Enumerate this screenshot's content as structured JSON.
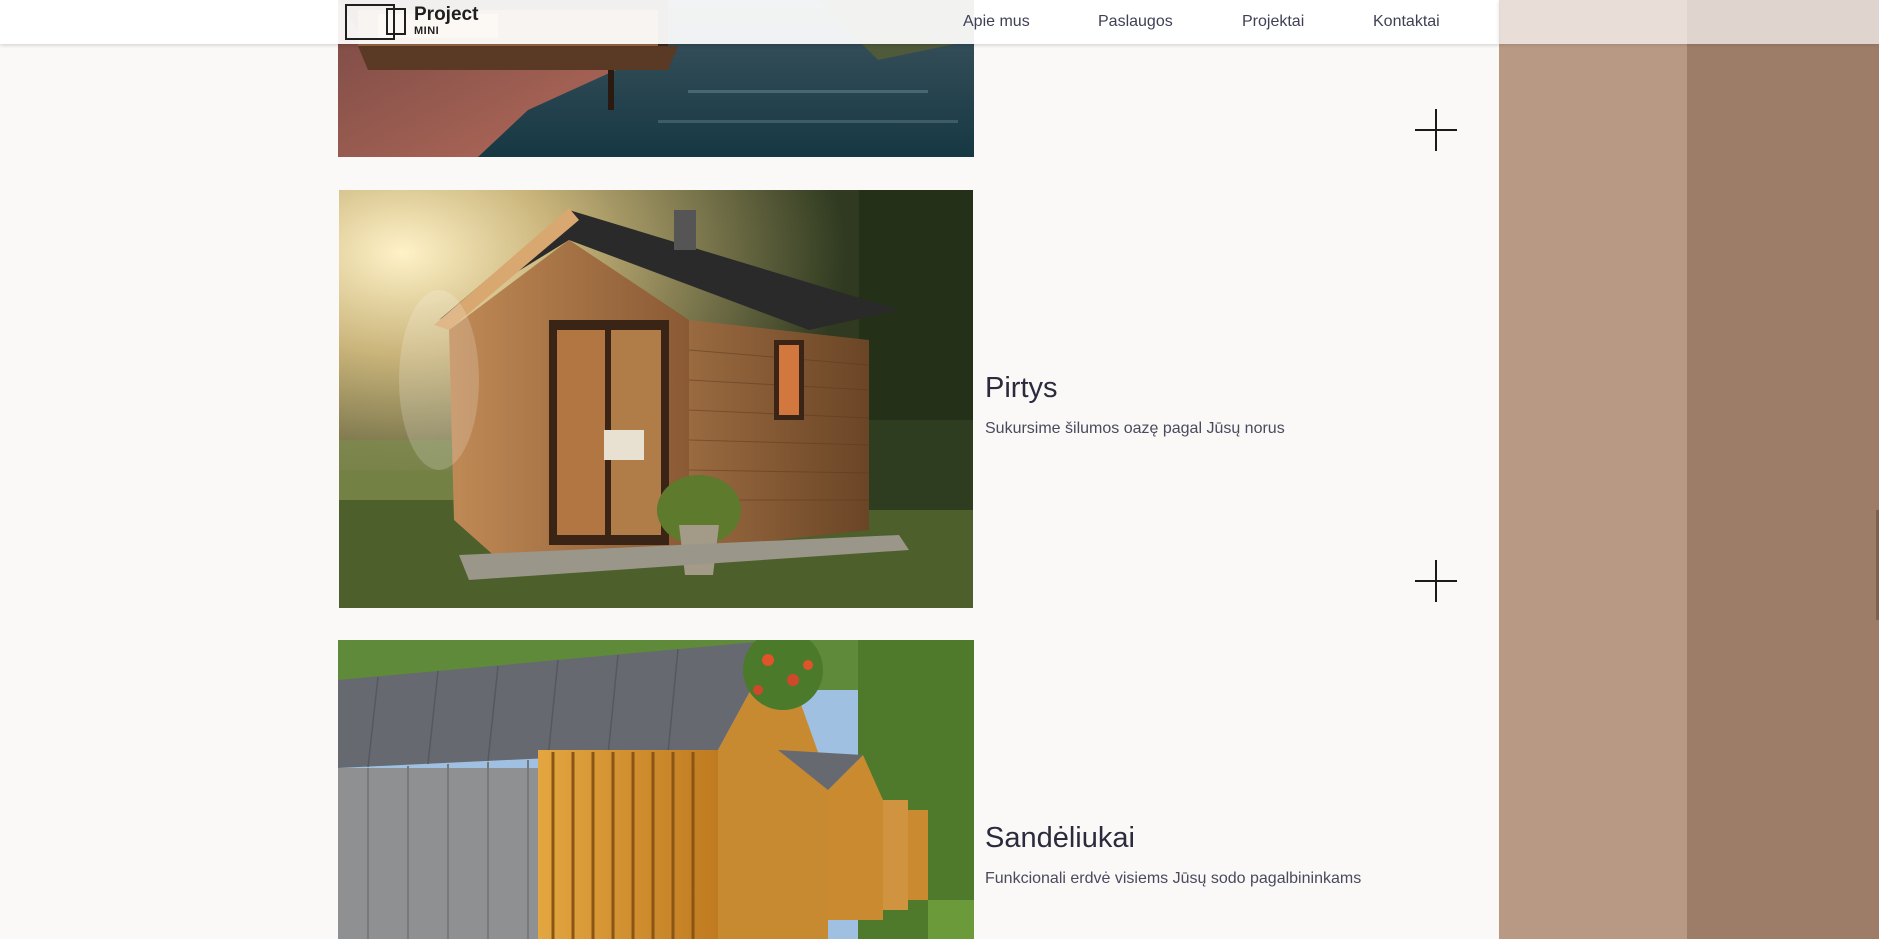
{
  "header": {
    "logo": {
      "word": "Project",
      "sub": "MINI"
    },
    "nav": [
      {
        "label": "Apie mus"
      },
      {
        "label": "Paslaugos"
      },
      {
        "label": "Projektai"
      },
      {
        "label": "Kontaktai"
      }
    ]
  },
  "services": [
    {
      "title": "Pirtys",
      "description": "Sukursime šilumos oazę pagal Jūsų norus"
    },
    {
      "title": "Sandėliukai",
      "description": "Funkcionali erdvė visiems Jūsų sodo pagalbininkams"
    }
  ],
  "colors": {
    "page_bg": "#faf9f7",
    "side_panel_light": "#b89a84",
    "side_panel_dark": "#9e7d68",
    "text_dark": "#2b2b3d"
  }
}
